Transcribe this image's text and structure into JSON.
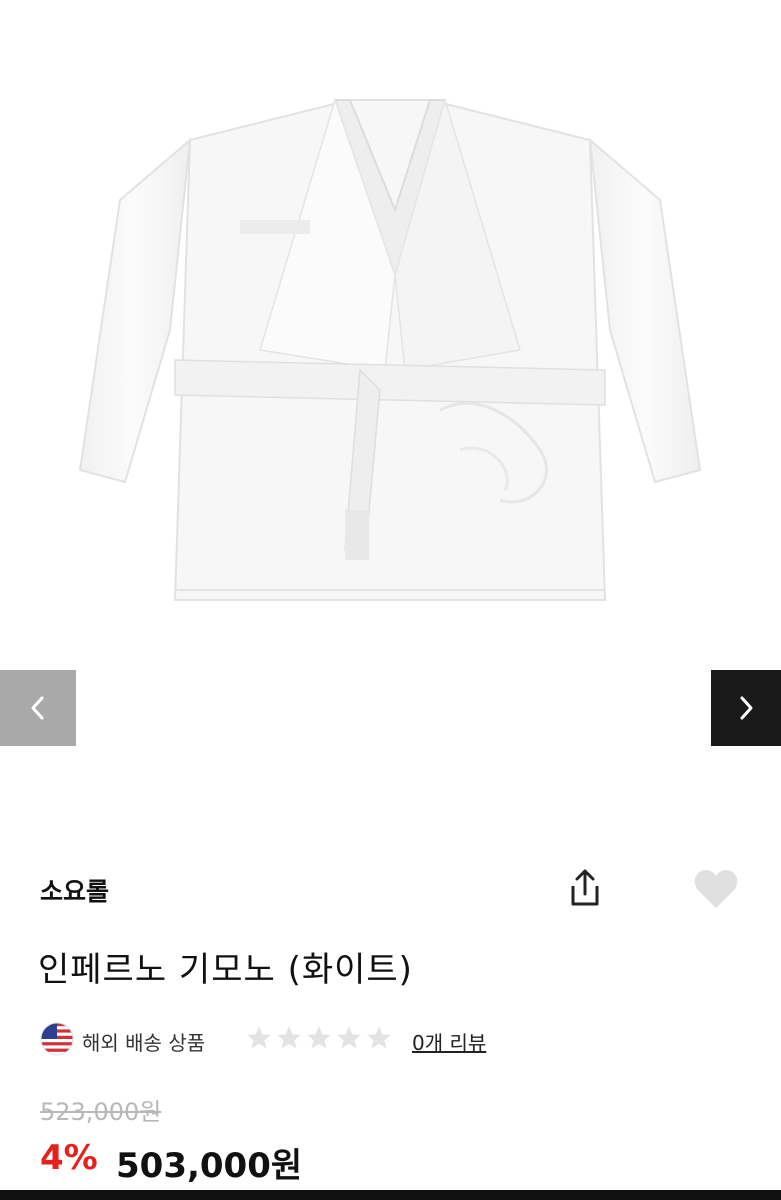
{
  "product": {
    "brand": "소요롤",
    "title": "인페르노 기모노 (화이트)",
    "shipping_label": "해외 배송 상품",
    "review_link": "0개 리뷰",
    "rating": 0,
    "rating_max": 5,
    "original_price": "523,000원",
    "discount": "4%",
    "final_price": "503,000원"
  },
  "icons": {
    "prev": "chevron-left-icon",
    "next": "chevron-right-icon",
    "share": "share-icon",
    "wishlist": "heart-icon",
    "flag": "us-flag-icon",
    "star": "star-icon"
  },
  "colors": {
    "discount": "#e8201c",
    "star_empty": "#e3e3e3",
    "heart": "#e0e0e0",
    "nav_prev_bg": "#a9a9a9",
    "nav_next_bg": "#1a1a1a"
  }
}
